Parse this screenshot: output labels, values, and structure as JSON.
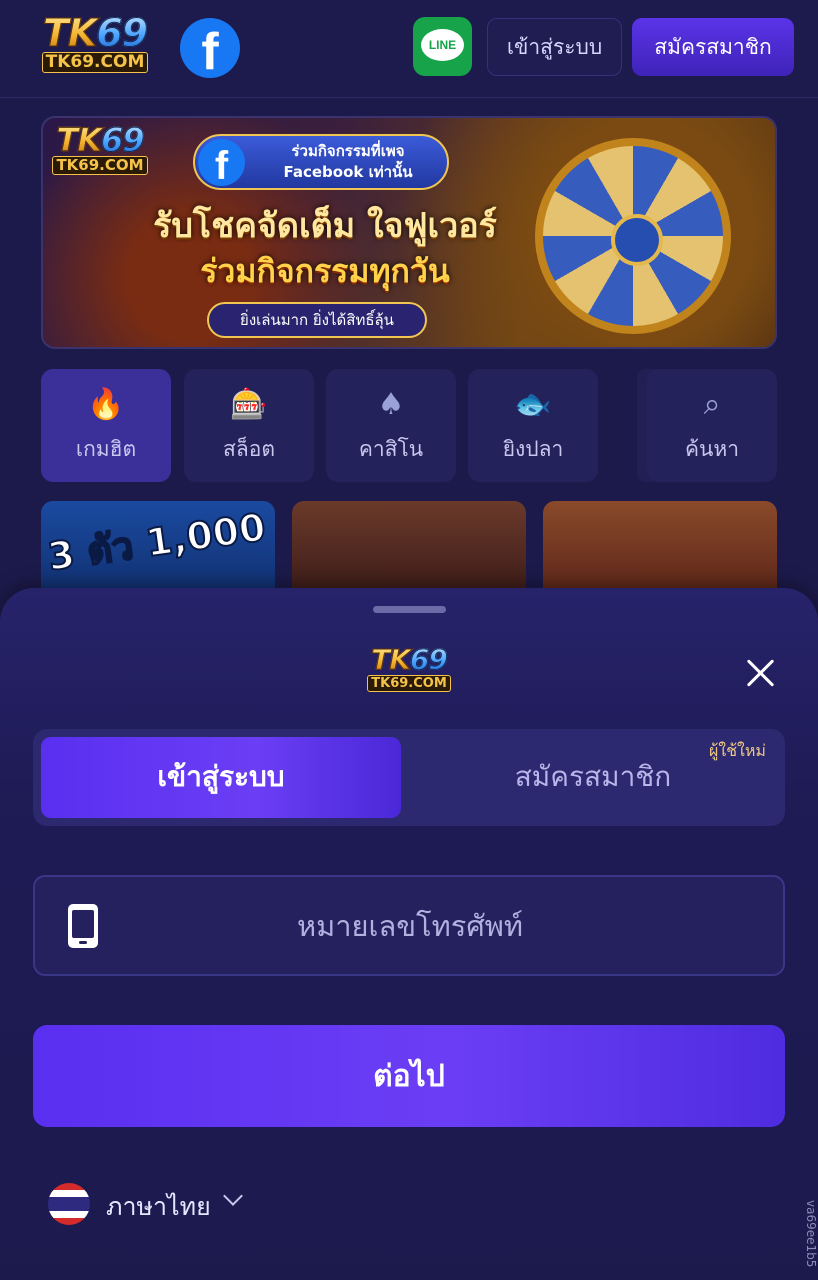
{
  "header": {
    "logo_big_tk": "TK",
    "logo_big_num": "69",
    "logo_small": "TK69.COM",
    "facebook_glyph": "f",
    "line_label": "LINE",
    "login_label": "เข้าสู่ระบบ",
    "register_label": "สมัครสมาชิก"
  },
  "banner": {
    "logo_big_tk": "TK",
    "logo_big_num": "69",
    "logo_small": "TK69.COM",
    "fb_line1": "ร่วมกิจกรรมที่เพจ",
    "fb_line2": "Facebook เท่านั้น",
    "headline1": "รับโชคจัดเต็ม ใจฟูเวอร์",
    "headline2": "ร่วมกิจกรรมทุกวัน",
    "sub": "ยิ่งเล่นมาก ยิ่งได้สิทธิ์ลุ้น"
  },
  "categories": [
    {
      "label": "เกมฮิต",
      "icon": "flame-icon",
      "glyph": "🔥"
    },
    {
      "label": "สล็อต",
      "icon": "slot-machine-icon",
      "glyph": "🎰"
    },
    {
      "label": "คาสิโน",
      "icon": "poker-chip-icon",
      "glyph": "♠"
    },
    {
      "label": "ยิงปลา",
      "icon": "fish-icon",
      "glyph": "🐟"
    },
    {
      "label": "ค้นหา",
      "icon": "search-icon",
      "glyph": "⌕"
    }
  ],
  "thumbs": [
    {
      "text": "3 ตัว 1,000"
    }
  ],
  "sheet": {
    "logo_big_tk": "TK",
    "logo_big_num": "69",
    "logo_small": "TK69.COM",
    "tab_login": "เข้าสู่ระบบ",
    "tab_register": "สมัครสมาชิก",
    "new_user_badge": "ผู้ใช้ใหม่",
    "phone_placeholder": "หมายเลขโทรศัพท์",
    "phone_value": "",
    "next_label": "ต่อไป",
    "language": "ภาษาไทย"
  },
  "watermark": "va69ee1b5",
  "colors": {
    "background": "#1c1a4a",
    "accent": "#5a2ff0",
    "brand_gold": "#f6c34a",
    "badge": "#f1c985"
  }
}
